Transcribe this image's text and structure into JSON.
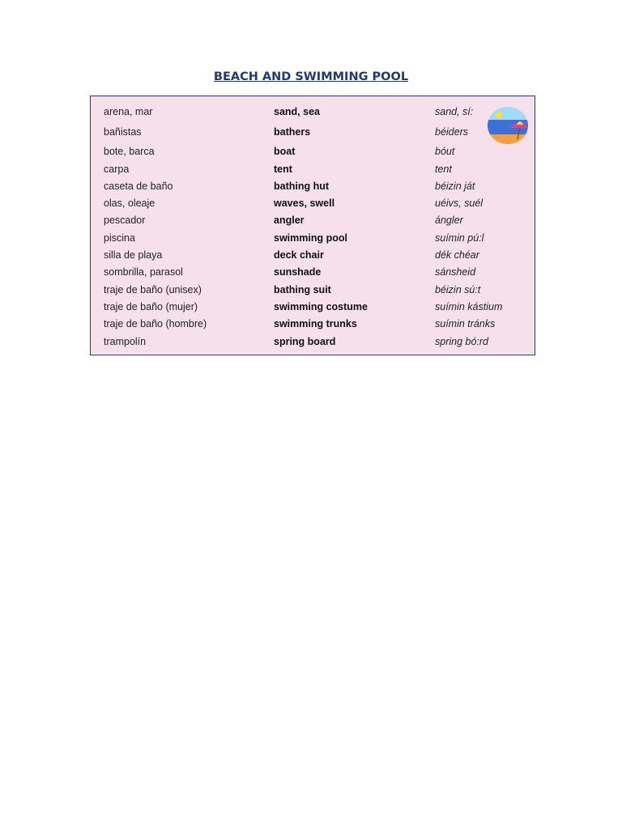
{
  "title": "BEACH AND SWIMMING POOL",
  "rows": [
    {
      "es": "arena, mar",
      "en": "sand, sea",
      "pron": "sand, sí:"
    },
    {
      "es": "bañistas",
      "en": "bathers",
      "pron": "béiders"
    },
    {
      "es": "bote, barca",
      "en": "boat",
      "pron": "bóut"
    },
    {
      "es": "carpa",
      "en": "tent",
      "pron": "tent"
    },
    {
      "es": "caseta de baño",
      "en": "bathing hut",
      "pron": "béizin ját"
    },
    {
      "es": "olas, oleaje",
      "en": "waves, swell",
      "pron": "uéivs, suél"
    },
    {
      "es": "pescador",
      "en": "angler",
      "pron": "ángler"
    },
    {
      "es": "piscina",
      "en": "swimming pool",
      "pron": "suímin pú:l"
    },
    {
      "es": "silla de playa",
      "en": "deck chair",
      "pron": "dék chéar"
    },
    {
      "es": "sombrilla, parasol",
      "en": "sunshade",
      "pron": "sánsheid"
    },
    {
      "es": "traje de baño (unisex)",
      "en": "bathing suit",
      "pron": "béizin sú:t"
    },
    {
      "es": "traje de baño (mujer)",
      "en": "swimming costume",
      "pron": "suímin kástium"
    },
    {
      "es": "traje de baño (hombre)",
      "en": "swimming trunks",
      "pron": "suímin tránks"
    },
    {
      "es": "trampolín",
      "en": "spring board",
      "pron": "spring bó:rd"
    }
  ]
}
